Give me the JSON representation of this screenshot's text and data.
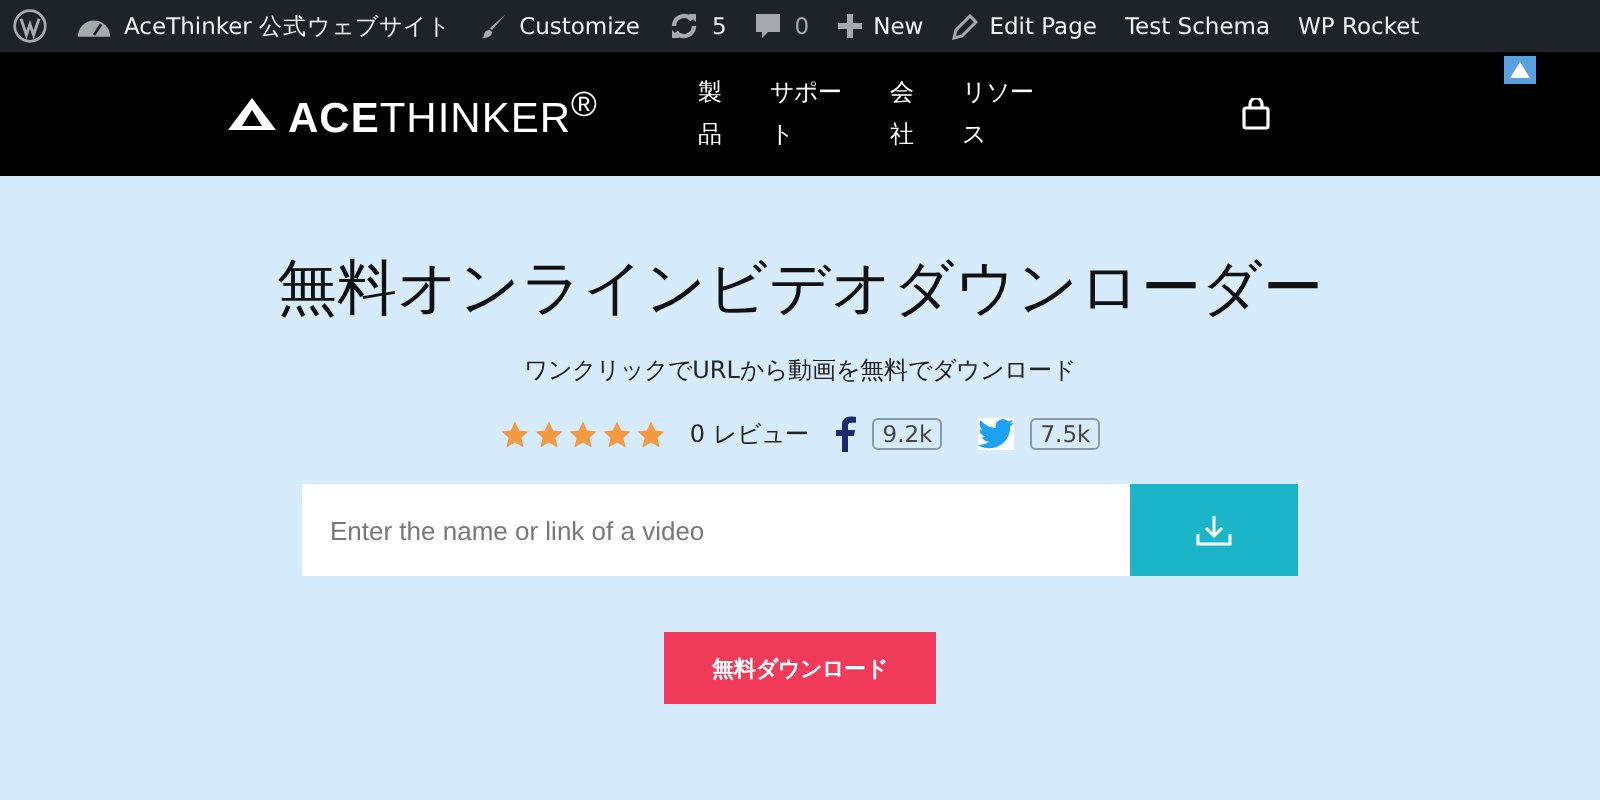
{
  "admin_bar": {
    "items": [
      {
        "kind": "wp"
      },
      {
        "kind": "site",
        "label": "AceThinker 公式ウェブサイト"
      },
      {
        "kind": "brush",
        "label": "Customize"
      },
      {
        "kind": "updates",
        "label": "5"
      },
      {
        "kind": "comments",
        "label": "0"
      },
      {
        "kind": "plus",
        "label": "New"
      },
      {
        "kind": "pencil",
        "label": "Edit Page"
      },
      {
        "kind": "text",
        "label": "Test Schema"
      },
      {
        "kind": "text",
        "label": "WP Rocket"
      }
    ]
  },
  "header": {
    "logo": "**ACE**THINKER$^{®}$",
    "nav": [
      "製品",
      "サポート",
      "会社",
      "リソース"
    ]
  },
  "hero": {
    "title": "無料オンラインビデオダウンローダー",
    "subtitle": "ワンクリックでURLから動画を無料でダウンロード",
    "stars": 5,
    "reviews": "0 レビュー",
    "facebook_count": "9.2k",
    "twitter_count": "7.5k",
    "search": {
      "placeholder": "Enter the name or link of a video"
    },
    "download_button": "無料ダウンロード"
  }
}
